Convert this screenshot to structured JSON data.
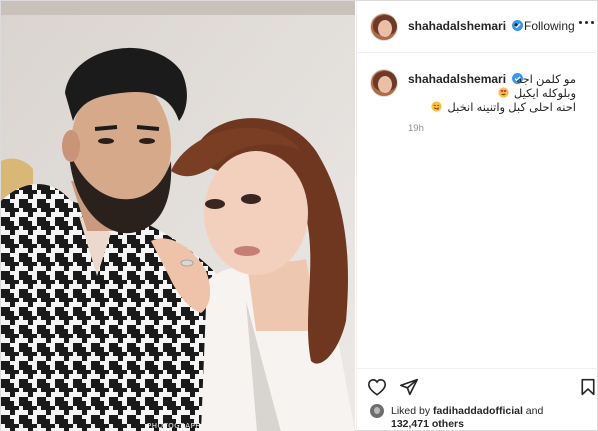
{
  "post": {
    "username": "shahadalshemari",
    "follow_separator": "•",
    "follow_label": "Following",
    "more_icon": "more-options-icon"
  },
  "caption": {
    "username": "shahadalshemari",
    "line1": "مو كلمن اجه",
    "line2": "وبلوكله ايكيل",
    "line3": "احنه احلى كبل واتنينه انخبل",
    "timestamp": "19h"
  },
  "photo": {
    "watermark": "PHOTOGRAPHY"
  },
  "actions": {
    "like_icon": "heart-icon",
    "share_icon": "share-icon",
    "save_icon": "bookmark-icon"
  },
  "likes": {
    "prefix": "Liked by",
    "user": "fadihaddadofficial",
    "and": "and",
    "count": "132,471 others"
  },
  "colors": {
    "verified_blue": "#3897f0",
    "text": "#262626",
    "muted": "#8e8e8e",
    "divider": "#efefef"
  }
}
